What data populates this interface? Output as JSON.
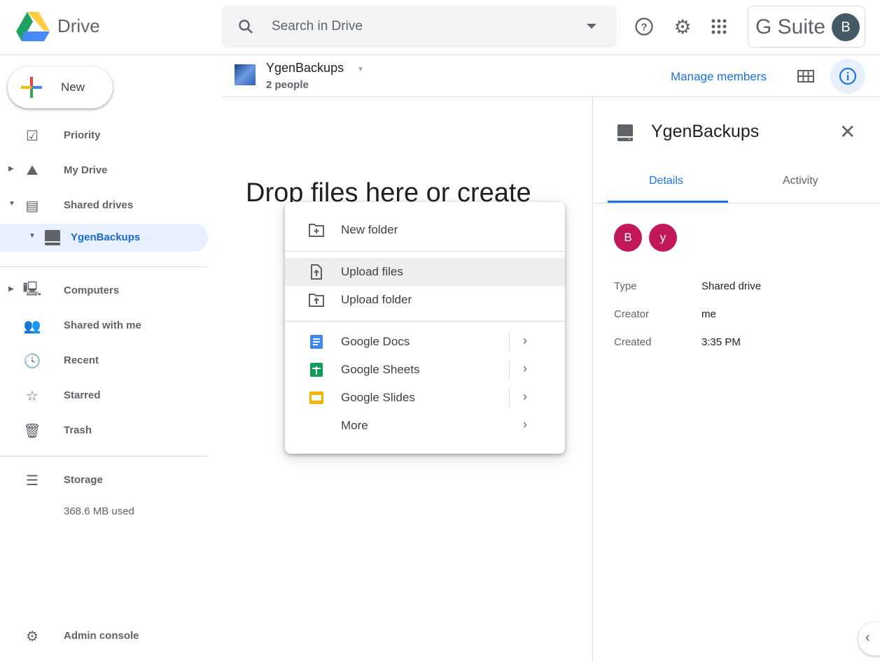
{
  "header": {
    "app_name": "Drive",
    "search_placeholder": "Search in Drive",
    "brand": "G Suite",
    "user_initial": "B"
  },
  "sidebar": {
    "new_label": "New",
    "items": [
      {
        "label": "Priority",
        "icon": "priority-icon"
      },
      {
        "label": "My Drive",
        "icon": "my-drive-icon"
      },
      {
        "label": "Shared drives",
        "icon": "shared-drives-icon"
      },
      {
        "label": "YgenBackups",
        "icon": "drive-icon",
        "selected": true
      },
      {
        "label": "Computers",
        "icon": "computers-icon"
      },
      {
        "label": "Shared with me",
        "icon": "people-icon"
      },
      {
        "label": "Recent",
        "icon": "clock-icon"
      },
      {
        "label": "Starred",
        "icon": "star-icon"
      },
      {
        "label": "Trash",
        "icon": "trash-icon"
      }
    ],
    "storage_label": "Storage",
    "storage_used": "368.6 MB used",
    "admin_label": "Admin console"
  },
  "drive_header": {
    "name": "YgenBackups",
    "members": "2 people",
    "manage_members": "Manage members"
  },
  "main": {
    "drop_text": "Drop files here or create"
  },
  "menu": {
    "items": [
      {
        "label": "New folder"
      },
      {
        "label": "Upload files",
        "highlighted": true
      },
      {
        "label": "Upload folder"
      },
      {
        "label": "Google Docs"
      },
      {
        "label": "Google Sheets"
      },
      {
        "label": "Google Slides"
      },
      {
        "label": "More"
      }
    ]
  },
  "details": {
    "title": "YgenBackups",
    "tabs": [
      {
        "label": "Details",
        "active": true
      },
      {
        "label": "Activity"
      }
    ],
    "members": [
      {
        "initial": "B"
      },
      {
        "initial": "y"
      }
    ],
    "rows": [
      {
        "key": "Type",
        "value": "Shared drive"
      },
      {
        "key": "Creator",
        "value": "me"
      },
      {
        "key": "Created",
        "value": "3:35 PM"
      }
    ]
  },
  "colors": {
    "accent": "#1a73e8",
    "member_avatar": "#c2185b",
    "user_avatar": "#455a64"
  }
}
